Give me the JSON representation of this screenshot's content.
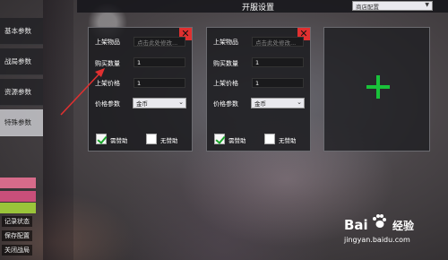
{
  "header": {
    "title": "开服设置",
    "select_value": "商店配置"
  },
  "sidebar": {
    "items": [
      {
        "label": "基本参数"
      },
      {
        "label": "战局参数"
      },
      {
        "label": "资源参数"
      },
      {
        "label": "特殊参数"
      }
    ]
  },
  "bottom_buttons": {
    "record": "记录状态",
    "save": "保存配置",
    "close": "关闭战局"
  },
  "panels": [
    {
      "item_label": "上架物品",
      "item_placeholder": "点击此处修改...",
      "qty_label": "购买数量",
      "qty_value": "1",
      "price_label": "上架价格",
      "price_value": "1",
      "param_label": "价格参数",
      "param_value": "金币",
      "need_assist_label": "需赞助",
      "no_assist_label": "无赞助",
      "close_symbol": "✕"
    },
    {
      "item_label": "上架物品",
      "item_placeholder": "点击此处修改...",
      "qty_label": "购买数量",
      "qty_value": "1",
      "price_label": "上架价格",
      "price_value": "1",
      "param_label": "价格参数",
      "param_value": "金币",
      "need_assist_label": "需赞助",
      "no_assist_label": "无赞助",
      "close_symbol": "✕"
    }
  ],
  "watermark": {
    "logo": "Bai",
    "brand": "经验",
    "url": "jingyan.baidu.com"
  },
  "colors": {
    "close_red": "#e03030",
    "plus_green": "#19c23a",
    "check_green": "#1aa52a",
    "arrow_red": "#e03030"
  }
}
